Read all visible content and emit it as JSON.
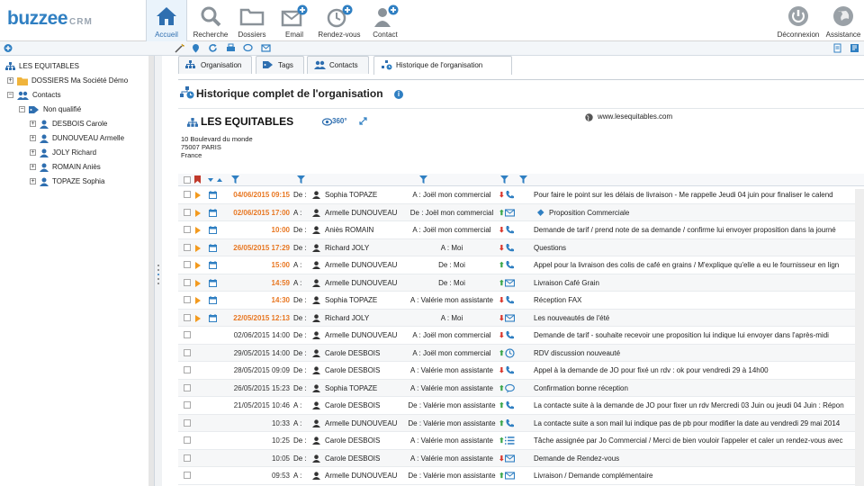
{
  "app": {
    "logo_main": "buzzee",
    "logo_sub": "CRM"
  },
  "nav": [
    {
      "label": "Accueil",
      "icon": "home-icon",
      "active": true
    },
    {
      "label": "Recherche",
      "icon": "search-icon",
      "active": false
    },
    {
      "label": "Dossiers",
      "icon": "folder-icon",
      "active": false
    },
    {
      "label": "Email",
      "icon": "email-add-icon",
      "active": false
    },
    {
      "label": "Rendez-vous",
      "icon": "clock-add-icon",
      "active": false
    },
    {
      "label": "Contact",
      "icon": "contact-add-icon",
      "active": false
    }
  ],
  "nav_right": [
    {
      "label": "Déconnexion",
      "icon": "power-icon"
    },
    {
      "label": "Assistance",
      "icon": "globe-icon"
    }
  ],
  "tree": {
    "root": "LES EQUITABLES",
    "dossiers": "DOSSIERS Ma Société Démo",
    "contacts": "Contacts",
    "group": "Non qualifié",
    "people": [
      "DESBOIS Carole",
      "DUNOUVEAU Armelle",
      "JOLY Richard",
      "ROMAIN Aniès",
      "TOPAZE Sophia"
    ]
  },
  "tabs": [
    "Organisation",
    "Tags",
    "Contacts",
    "Historique de l'organisation"
  ],
  "page_title": "Historique complet de l'organisation",
  "org": {
    "name": "LES EQUITABLES",
    "badge": "360°",
    "address1": "10 Boulevard du monde",
    "address2": "75007 PARIS",
    "country": "France",
    "website": "www.lesequitables.com"
  },
  "rows": [
    {
      "flag": true,
      "cal": true,
      "date": "04/06/2015 09:15",
      "hi": true,
      "dir1": "De :",
      "who": "Sophia TOPAZE",
      "dir2": "A : Joël mon commercial",
      "arrow": "down",
      "type": "phone-icon",
      "subject": "Pour faire le point sur les délais de livraison - Me rappelle Jeudi 04 juin pour finaliser le calend"
    },
    {
      "flag": true,
      "cal": true,
      "date": "02/06/2015 17:00",
      "hi": true,
      "dir1": "A :",
      "who": "Armelle DUNOUVEAU",
      "dir2": "De : Joël mon commercial",
      "arrow": "up",
      "type": "email-icon",
      "subject": "Proposition Commerciale",
      "attach": true
    },
    {
      "flag": true,
      "cal": true,
      "date": "10:00",
      "hi": true,
      "dir1": "De :",
      "who": "Aniès ROMAIN",
      "dir2": "A : Joël mon commercial",
      "arrow": "down",
      "type": "phone-icon",
      "subject": "Demande de tarif / prend note de sa demande / confirme lui envoyer proposition dans la journé"
    },
    {
      "flag": true,
      "cal": true,
      "date": "26/05/2015 17:29",
      "hi": true,
      "dir1": "De :",
      "who": "Richard JOLY",
      "dir2": "A : Moi",
      "arrow": "down",
      "type": "phone-icon",
      "subject": "Questions"
    },
    {
      "flag": true,
      "cal": true,
      "date": "15:00",
      "hi": true,
      "dir1": "A :",
      "who": "Armelle DUNOUVEAU",
      "dir2": "De : Moi",
      "arrow": "up",
      "type": "phone-icon",
      "subject": "Appel pour la livraison des colis de café en grains / M'explique qu'elle a eu le fournisseur en lign"
    },
    {
      "flag": true,
      "cal": true,
      "date": "14:59",
      "hi": true,
      "dir1": "A :",
      "who": "Armelle DUNOUVEAU",
      "dir2": "De : Moi",
      "arrow": "up",
      "type": "email-icon",
      "subject": "Livraison Café Grain"
    },
    {
      "flag": true,
      "cal": true,
      "date": "14:30",
      "hi": true,
      "dir1": "De :",
      "who": "Sophia TOPAZE",
      "dir2": "A : Valérie mon assistante",
      "arrow": "down",
      "type": "phone-icon",
      "subject": "Réception FAX"
    },
    {
      "flag": true,
      "cal": true,
      "date": "22/05/2015 12:13",
      "hi": true,
      "dir1": "De :",
      "who": "Richard JOLY",
      "dir2": "A : Moi",
      "arrow": "down",
      "type": "email-icon",
      "subject": "Les nouveautés de l'été"
    },
    {
      "flag": false,
      "cal": false,
      "date": "02/06/2015 14:00",
      "hi": false,
      "dir1": "De :",
      "who": "Armelle DUNOUVEAU",
      "dir2": "A : Joël mon commercial",
      "arrow": "down",
      "type": "phone-icon",
      "subject": "Demande de tarif - souhaite recevoir une proposition lui indique lui envoyer dans l'après-midi"
    },
    {
      "flag": false,
      "cal": false,
      "date": "29/05/2015 14:00",
      "hi": false,
      "dir1": "De :",
      "who": "Carole DESBOIS",
      "dir2": "A : Joël mon commercial",
      "arrow": "up",
      "type": "clock-icon",
      "subject": "RDV discussion nouveauté"
    },
    {
      "flag": false,
      "cal": false,
      "date": "28/05/2015 09:09",
      "hi": false,
      "dir1": "De :",
      "who": "Carole DESBOIS",
      "dir2": "A : Valérie mon assistante",
      "arrow": "down",
      "type": "phone-icon",
      "subject": "Appel à la demande de JO pour fixé un rdv : ok pour vendredi 29 à 14h00"
    },
    {
      "flag": false,
      "cal": false,
      "date": "26/05/2015 15:23",
      "hi": false,
      "dir1": "De :",
      "who": "Sophia TOPAZE",
      "dir2": "A : Valérie mon assistante",
      "arrow": "up",
      "type": "chat-icon",
      "subject": "Confirmation bonne réception"
    },
    {
      "flag": false,
      "cal": false,
      "date": "21/05/2015 10:46",
      "hi": false,
      "dir1": "A :",
      "who": "Carole DESBOIS",
      "dir2": "De : Valérie mon assistante",
      "arrow": "up",
      "type": "phone-icon",
      "subject": "La contacte suite à la demande de JO pour fixer un rdv Mercredi 03 Juin ou jeudi 04 Juin : Répon"
    },
    {
      "flag": false,
      "cal": false,
      "date": "10:33",
      "hi": false,
      "dir1": "A :",
      "who": "Armelle DUNOUVEAU",
      "dir2": "De : Valérie mon assistante",
      "arrow": "up",
      "type": "phone-icon",
      "subject": "La contacte suite a son mail lui indique pas de pb pour modifier la date au vendredi 29 mai 2014"
    },
    {
      "flag": false,
      "cal": false,
      "date": "10:25",
      "hi": false,
      "dir1": "De :",
      "who": "Carole DESBOIS",
      "dir2": "A : Valérie mon assistante",
      "arrow": "up",
      "type": "list-icon",
      "subject": "Tâche assignée par Jo Commercial / Merci de bien vouloir l'appeler et caler un rendez-vous avec"
    },
    {
      "flag": false,
      "cal": false,
      "date": "10:05",
      "hi": false,
      "dir1": "De :",
      "who": "Carole DESBOIS",
      "dir2": "A : Valérie mon assistante",
      "arrow": "down",
      "type": "email-icon",
      "subject": "Demande de Rendez-vous"
    },
    {
      "flag": false,
      "cal": false,
      "date": "09:53",
      "hi": false,
      "dir1": "A :",
      "who": "Armelle DUNOUVEAU",
      "dir2": "De : Valérie mon assistante",
      "arrow": "up",
      "type": "email-icon",
      "subject": "Livraison / Demande complémentaire"
    }
  ],
  "colors": {
    "accent": "#2f7fc2",
    "date_highlight": "#e87722",
    "arrow_down": "#d9352b",
    "arrow_up": "#3aa54a"
  }
}
